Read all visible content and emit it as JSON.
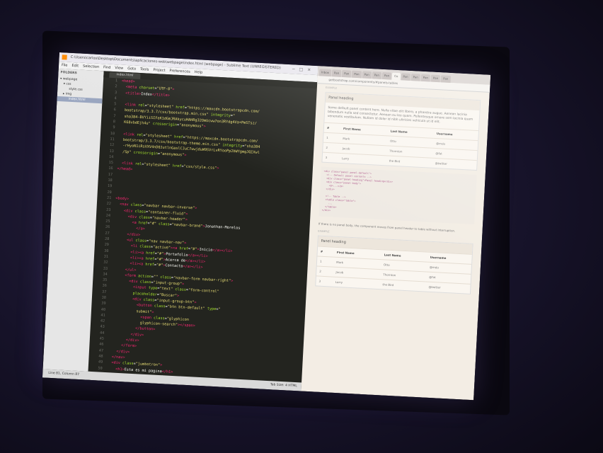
{
  "sublime": {
    "title": "C:\\Users\\carlos\\Desktop\\Documents\\aplicaciones-web\\webpage\\index.html (webpage) - Sublime Text (UNREGISTERED)",
    "menu": [
      "File",
      "Edit",
      "Selection",
      "Find",
      "View",
      "Goto",
      "Tools",
      "Project",
      "Preferences",
      "Help"
    ],
    "sidebar": {
      "header": "FOLDERS",
      "items": [
        "webpage",
        "css",
        "style.css",
        "img",
        "index.html"
      ]
    },
    "tab": "index.html",
    "line_numbers": [
      "1",
      "2",
      "3",
      "4",
      "5",
      "6",
      "7",
      "8",
      "9",
      "10",
      "11",
      "12",
      "13",
      "14",
      "15",
      "16",
      "17",
      "18",
      "19",
      "20",
      "21",
      "22",
      "23",
      "24",
      "25",
      "26",
      "27",
      "28",
      "29",
      "30",
      "31",
      "32",
      "33",
      "34",
      "35",
      "36",
      "37",
      "38",
      "39",
      "40",
      "41",
      "42",
      "43",
      "44",
      "45",
      "46",
      "47",
      "48",
      "49",
      "50"
    ],
    "status_left": "Line 81, Column 87",
    "status_right": "Tab Size: 4     HTML"
  },
  "browser": {
    "tabs": [
      "Inbox",
      "Pan",
      "Pan",
      "Pan",
      "Pan",
      "Pan",
      "Pan",
      "Co",
      "Pan",
      "Pan",
      "Pan",
      "Pan",
      "Pan"
    ],
    "address": "getbootstrap.com/components/#panels-tables",
    "example_label": "EXAMPLE",
    "panel_heading": "Panel heading",
    "panel_body": "Some default panel content here. Nulla vitae elit libero, a pharetra augue. Aenean lacinia bibendum nulla sed consectetur. Aenean eu leo quam. Pellentesque ornare sem lacinia quam venenatis vestibulum. Nullam id dolor id nibh ultricies vehicula ut id elit.",
    "table_headers": [
      "#",
      "First Name",
      "Last Name",
      "Username"
    ],
    "table_rows": [
      [
        "1",
        "Mark",
        "Otto",
        "@mdo"
      ],
      [
        "2",
        "Jacob",
        "Thornton",
        "@fat"
      ],
      [
        "3",
        "Larry",
        "the Bird",
        "@twitter"
      ]
    ],
    "note": "If there is no panel body, the component moves from panel header to table without interruption.",
    "example_label2": "EXAMPLE",
    "panel_heading2": "Panel heading",
    "table_rows2": [
      [
        "1",
        "Mark",
        "Otto",
        "@mdo"
      ],
      [
        "2",
        "Jacob",
        "Thornton",
        "@fat"
      ],
      [
        "3",
        "Larry",
        "the Bird",
        "@twitter"
      ]
    ]
  }
}
